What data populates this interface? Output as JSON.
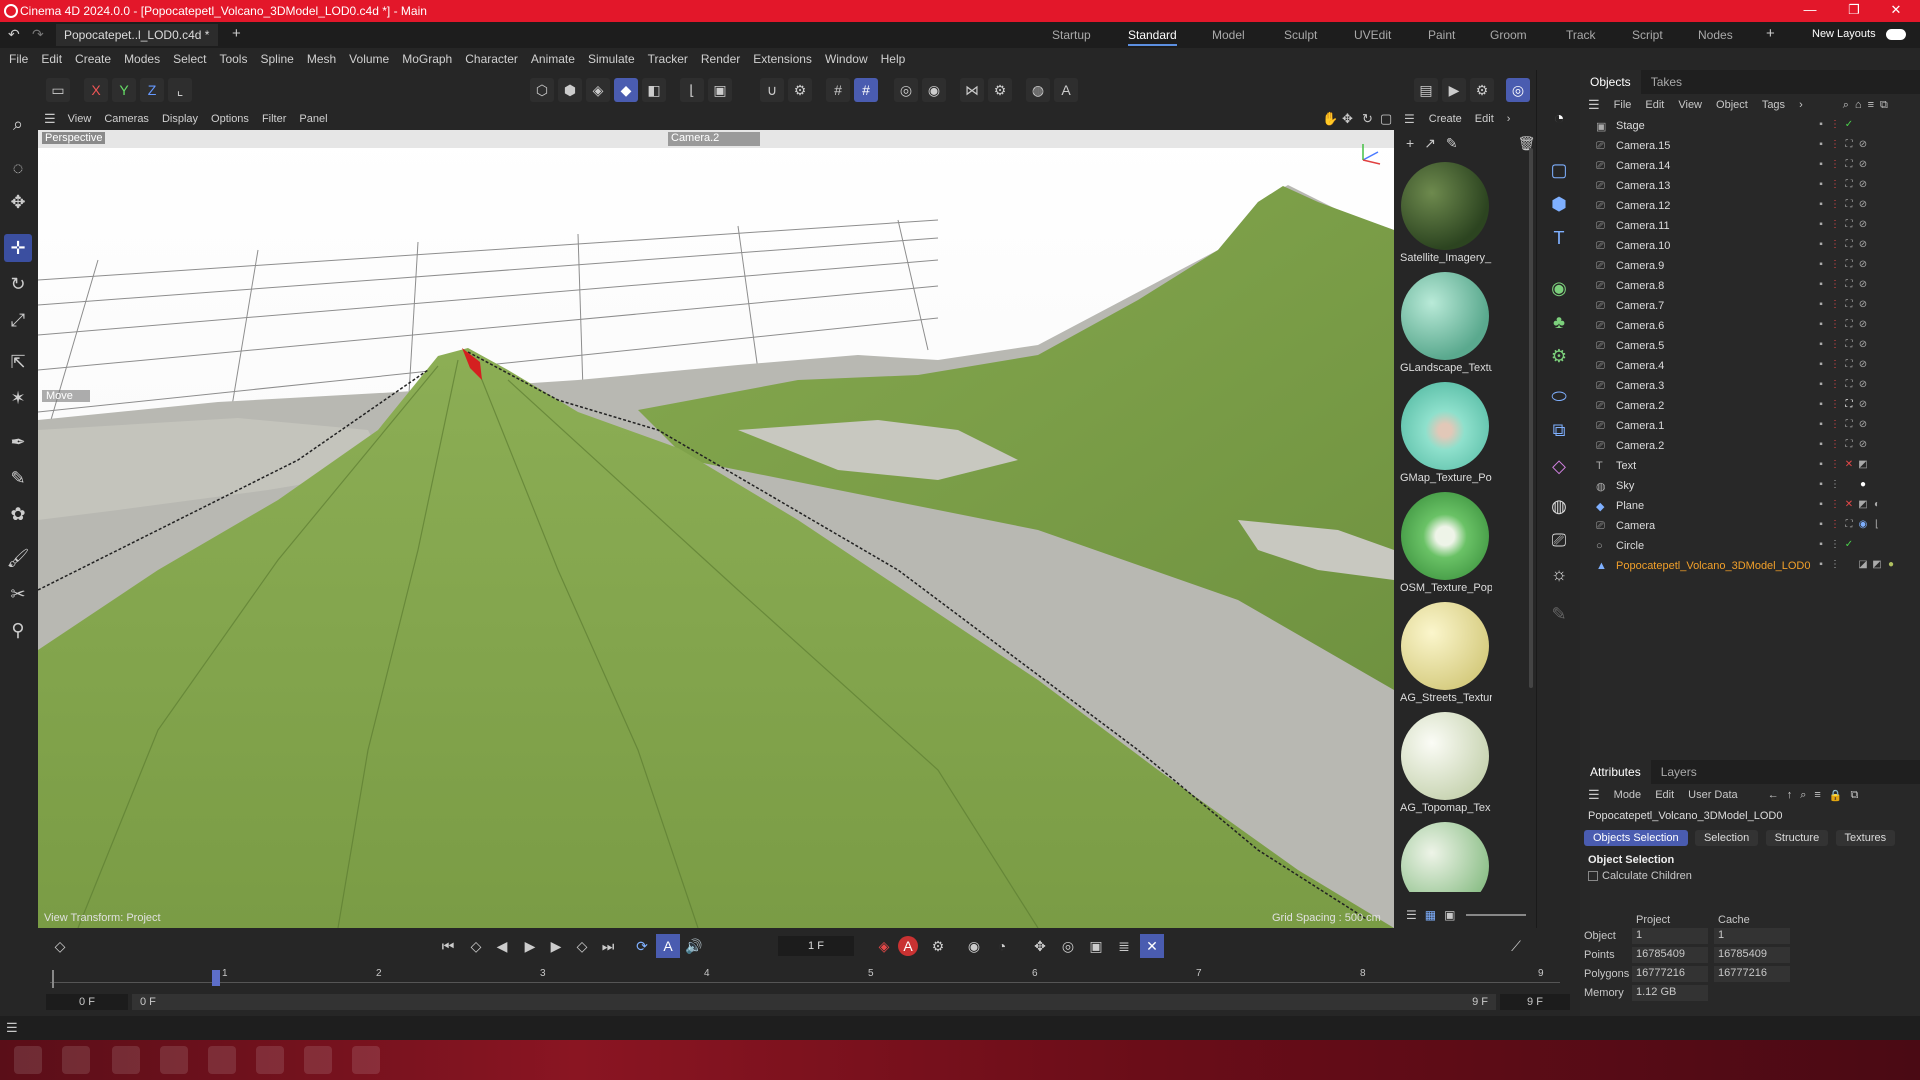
{
  "window": {
    "title": "Cinema 4D 2024.0.0 - [Popocatepetl_Volcano_3DModel_LOD0.c4d *] - Main"
  },
  "doc_tab": {
    "label": "Popocatepet..l_LOD0.c4d *"
  },
  "layouts": [
    "Startup",
    "Standard",
    "Model",
    "Sculpt",
    "UVEdit",
    "Paint",
    "Groom",
    "Track",
    "Script",
    "Nodes"
  ],
  "layout_active": "Standard",
  "new_layouts": "New Layouts",
  "menu": [
    "File",
    "Edit",
    "Create",
    "Modes",
    "Select",
    "Tools",
    "Spline",
    "Mesh",
    "Volume",
    "MoGraph",
    "Character",
    "Animate",
    "Simulate",
    "Tracker",
    "Render",
    "Extensions",
    "Window",
    "Help"
  ],
  "axis_buttons": [
    "X",
    "Y",
    "Z"
  ],
  "viewport": {
    "menu": [
      "View",
      "Cameras",
      "Display",
      "Options",
      "Filter",
      "Panel"
    ],
    "label": "Perspective",
    "camera": "Camera.2",
    "move_label": "Move",
    "view_transform": "View Transform: Project",
    "grid_spacing": "Grid Spacing : 500 cm"
  },
  "material_panel": {
    "menu": [
      "Create",
      "Edit"
    ],
    "materials": [
      {
        "name": "Satellite_Imagery_",
        "color": "#3e5a2a"
      },
      {
        "name": "GLandscape_Textu",
        "color": "#6fc3a8"
      },
      {
        "name": "GMap_Texture_Po",
        "color": "#7fd6c0"
      },
      {
        "name": "OSM_Texture_Pop",
        "color": "#5db35a"
      },
      {
        "name": "AG_Streets_Textur",
        "color": "#e8e0a0"
      },
      {
        "name": "AG_Topomap_Tex",
        "color": "#d8e2c8"
      },
      {
        "name": "",
        "color": "#8ec08a"
      }
    ]
  },
  "object_manager": {
    "tabs": [
      "Objects",
      "Takes"
    ],
    "menu": [
      "File",
      "Edit",
      "View",
      "Object",
      "Tags"
    ],
    "objects": [
      {
        "name": "Stage",
        "icon": "stage-icon"
      },
      {
        "name": "Camera.15",
        "icon": "camera-icon"
      },
      {
        "name": "Camera.14",
        "icon": "camera-icon"
      },
      {
        "name": "Camera.13",
        "icon": "camera-icon"
      },
      {
        "name": "Camera.12",
        "icon": "camera-icon"
      },
      {
        "name": "Camera.11",
        "icon": "camera-icon"
      },
      {
        "name": "Camera.10",
        "icon": "camera-icon"
      },
      {
        "name": "Camera.9",
        "icon": "camera-icon"
      },
      {
        "name": "Camera.8",
        "icon": "camera-icon"
      },
      {
        "name": "Camera.7",
        "icon": "camera-icon"
      },
      {
        "name": "Camera.6",
        "icon": "camera-icon"
      },
      {
        "name": "Camera.5",
        "icon": "camera-icon"
      },
      {
        "name": "Camera.4",
        "icon": "camera-icon"
      },
      {
        "name": "Camera.3",
        "icon": "camera-icon"
      },
      {
        "name": "Camera.2",
        "icon": "camera-icon"
      },
      {
        "name": "Camera.1",
        "icon": "camera-icon"
      },
      {
        "name": "Camera.2",
        "icon": "camera-icon"
      },
      {
        "name": "Text",
        "icon": "text-icon"
      },
      {
        "name": "Sky",
        "icon": "sky-icon"
      },
      {
        "name": "Plane",
        "icon": "plane-icon"
      },
      {
        "name": "Camera",
        "icon": "camera-icon"
      },
      {
        "name": "Circle",
        "icon": "circle-icon"
      },
      {
        "name": "Popocatepetl_Volcano_3DModel_LOD0",
        "icon": "polygon-icon",
        "highlight": true
      }
    ]
  },
  "attributes": {
    "tabs": [
      "Attributes",
      "Layers"
    ],
    "menu": [
      "Mode",
      "Edit",
      "User Data"
    ],
    "object_name": "Popocatepetl_Volcano_3DModel_LOD0",
    "buttons": [
      "Objects Selection",
      "Selection",
      "Structure",
      "Textures"
    ],
    "section": "Object Selection",
    "checkbox": "Calculate Children",
    "col_headers": [
      "Project",
      "Cache"
    ],
    "rows": [
      {
        "label": "Object",
        "project": "1",
        "cache": "1"
      },
      {
        "label": "Points",
        "project": "16785409",
        "cache": "16785409"
      },
      {
        "label": "Polygons",
        "project": "16777216",
        "cache": "16777216"
      },
      {
        "label": "Memory",
        "project": "1.12 GB",
        "cache": ""
      }
    ]
  },
  "timeline": {
    "frame": "1 F",
    "ruler": [
      "1",
      "2",
      "3",
      "4",
      "5",
      "6",
      "7",
      "8",
      "9"
    ],
    "start": "0 F",
    "start2": "0 F",
    "end": "9 F",
    "end2": "9 F"
  },
  "colors": {
    "accent": "#4a5cb0",
    "titlebar": "#e3172a",
    "terrain": "#7ea04a"
  }
}
